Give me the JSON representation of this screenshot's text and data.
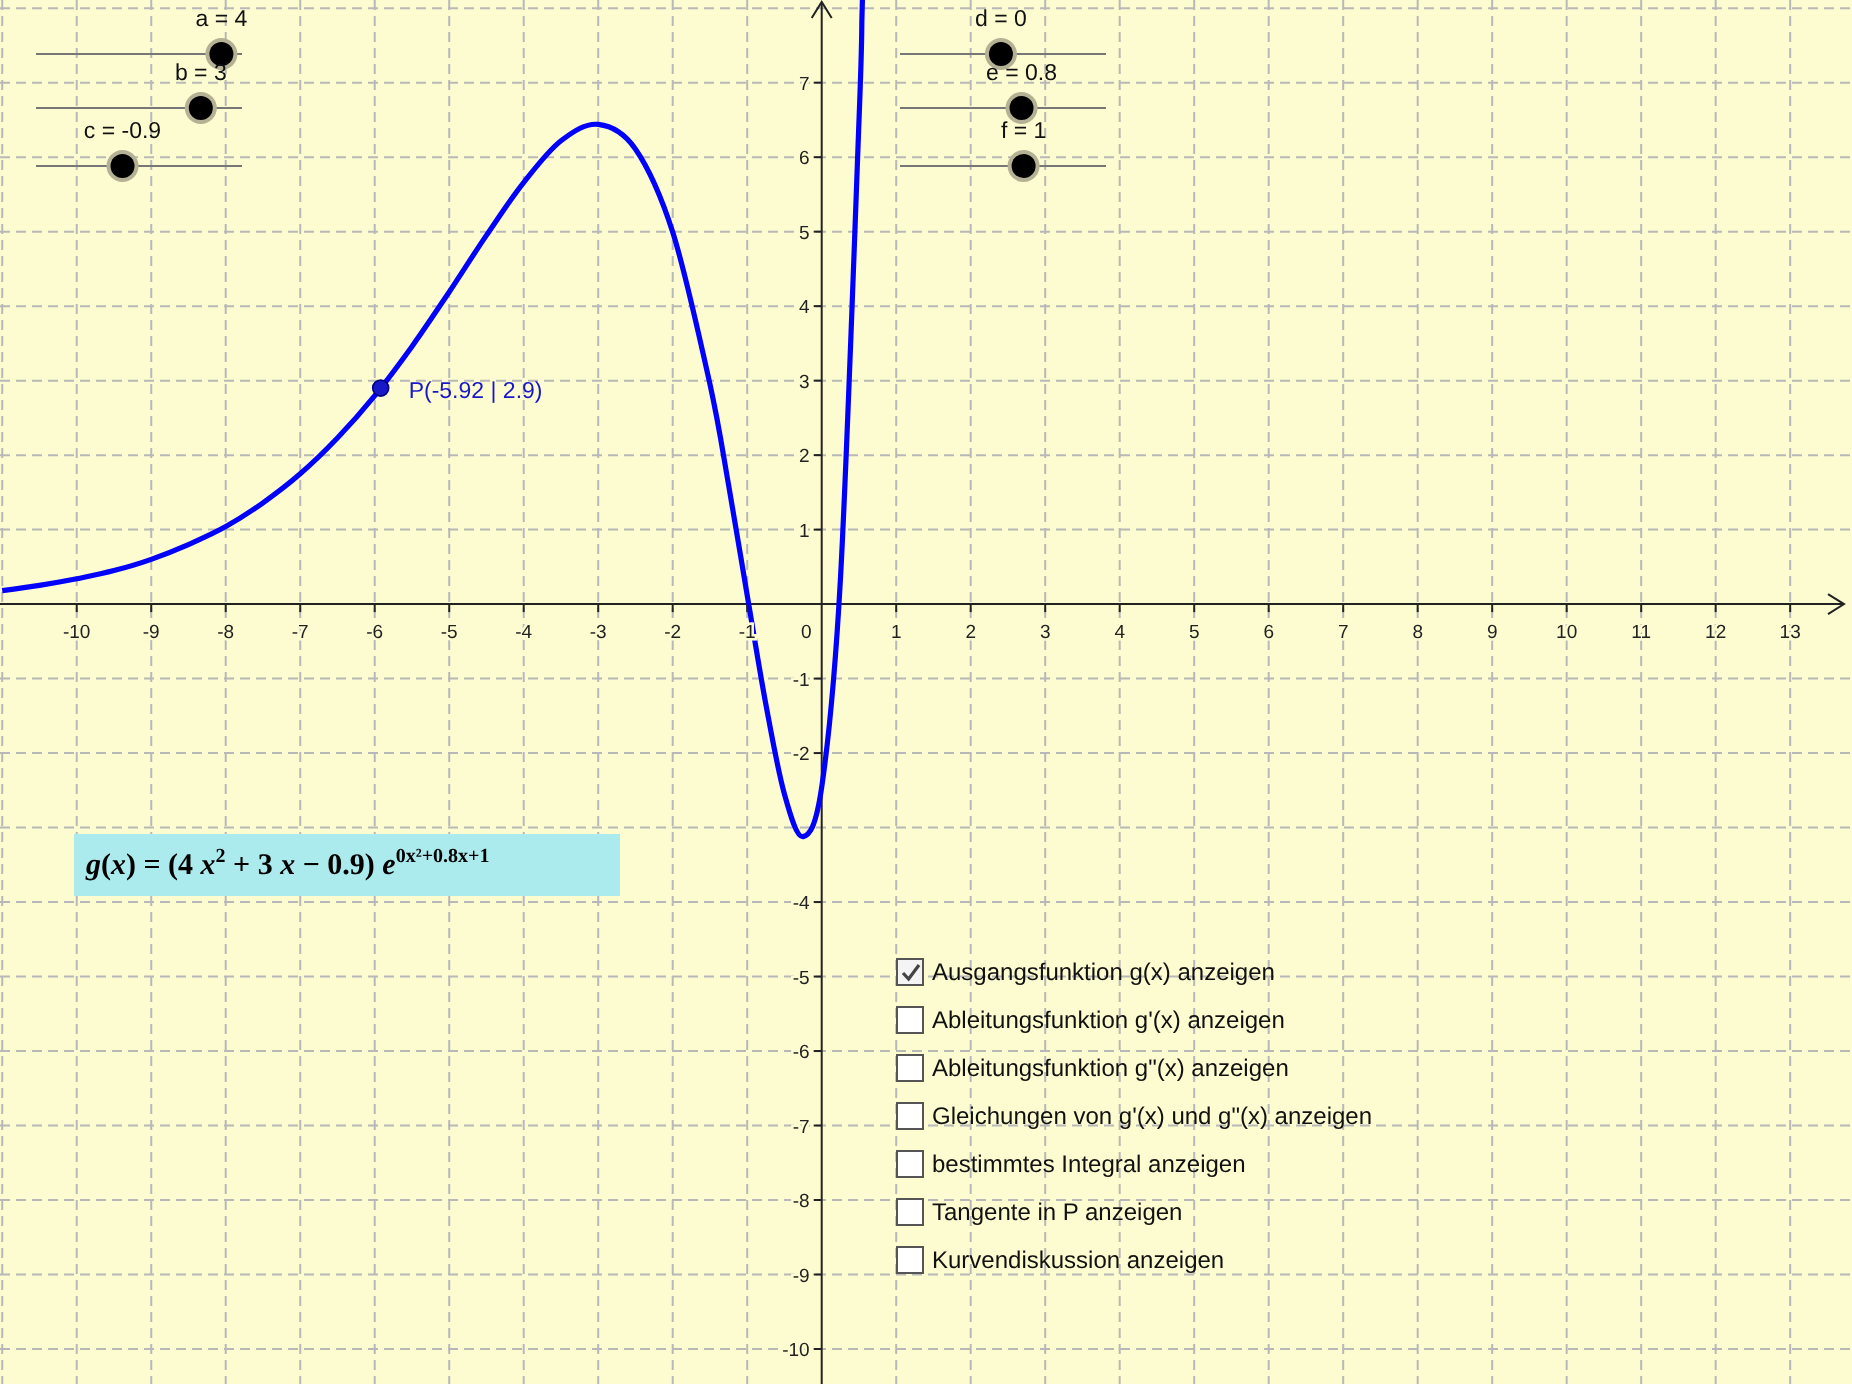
{
  "graph": {
    "chart_data": {
      "type": "line",
      "grid": true,
      "xlim": [
        -11.03,
        13.83
      ],
      "ylim": [
        -10.47,
        8.11
      ],
      "xticks": [
        -10,
        -9,
        -8,
        -7,
        -6,
        -5,
        -4,
        -3,
        -2,
        -1,
        1,
        2,
        3,
        4,
        5,
        6,
        7,
        8,
        9,
        10,
        11,
        12,
        13
      ],
      "yticks": [
        -10,
        -9,
        -8,
        -7,
        -6,
        -5,
        -4,
        -2,
        -1,
        1,
        2,
        3,
        4,
        5,
        6,
        7
      ],
      "x": [
        -11,
        -10.5,
        -10,
        -9.5,
        -9,
        -8.5,
        -8,
        -7.5,
        -7,
        -6.5,
        -6,
        -5.5,
        -5,
        -4.5,
        -4,
        -3.5,
        -3,
        -2.5,
        -2,
        -1.5,
        -1.25,
        -1,
        -0.75,
        -0.5,
        -0.25,
        0,
        0.25,
        0.5,
        0.54
      ],
      "series": [
        {
          "color": "#0000ff",
          "values": [
            0.18,
            0.25,
            0.34,
            0.45,
            0.6,
            0.8,
            1.04,
            1.36,
            1.75,
            2.23,
            2.8,
            3.46,
            4.19,
            4.95,
            5.66,
            6.22,
            6.44,
            6.11,
            4.99,
            2.95,
            1.6,
            0.12,
            -1.34,
            -2.55,
            -3.12,
            -2.45,
            0.33,
            6.49,
            7.9
          ]
        }
      ],
      "annotations": [
        {
          "x": -5.92,
          "y": 2.9,
          "text": "P(-5.92 | 2.9)"
        }
      ]
    },
    "origin_label": "0"
  },
  "sliders": [
    {
      "label": "a = 4",
      "level": 0.9
    },
    {
      "label": "b = 3",
      "level": 0.8
    },
    {
      "label": "c = -0.9",
      "level": 0.42
    },
    {
      "label": "d = 0",
      "level": 0.49
    },
    {
      "label": "e = 0.8",
      "level": 0.59
    },
    {
      "label": "f = 1",
      "level": 0.6
    }
  ],
  "formula": "*g*(*x*) = (4 *x*$^{2}$ + 3 *x* − 0.9)  *e*$^{0x²+0.8x+1}$",
  "checkboxes": [
    {
      "label": "Ausgangsfunktion g(x) anzeigen",
      "checked": true
    },
    {
      "label": "Ableitungsfunktion g'(x) anzeigen",
      "checked": false
    },
    {
      "label": "Ableitungsfunktion g\"(x) anzeigen",
      "checked": false
    },
    {
      "label": "Gleichungen von g'(x) und g\"(x) anzeigen",
      "checked": false
    },
    {
      "label": "bestimmtes Integral anzeigen",
      "checked": false
    },
    {
      "label": "Tangente in P anzeigen",
      "checked": false
    },
    {
      "label": "Kurvendiskussion anzeigen",
      "checked": false
    }
  ]
}
